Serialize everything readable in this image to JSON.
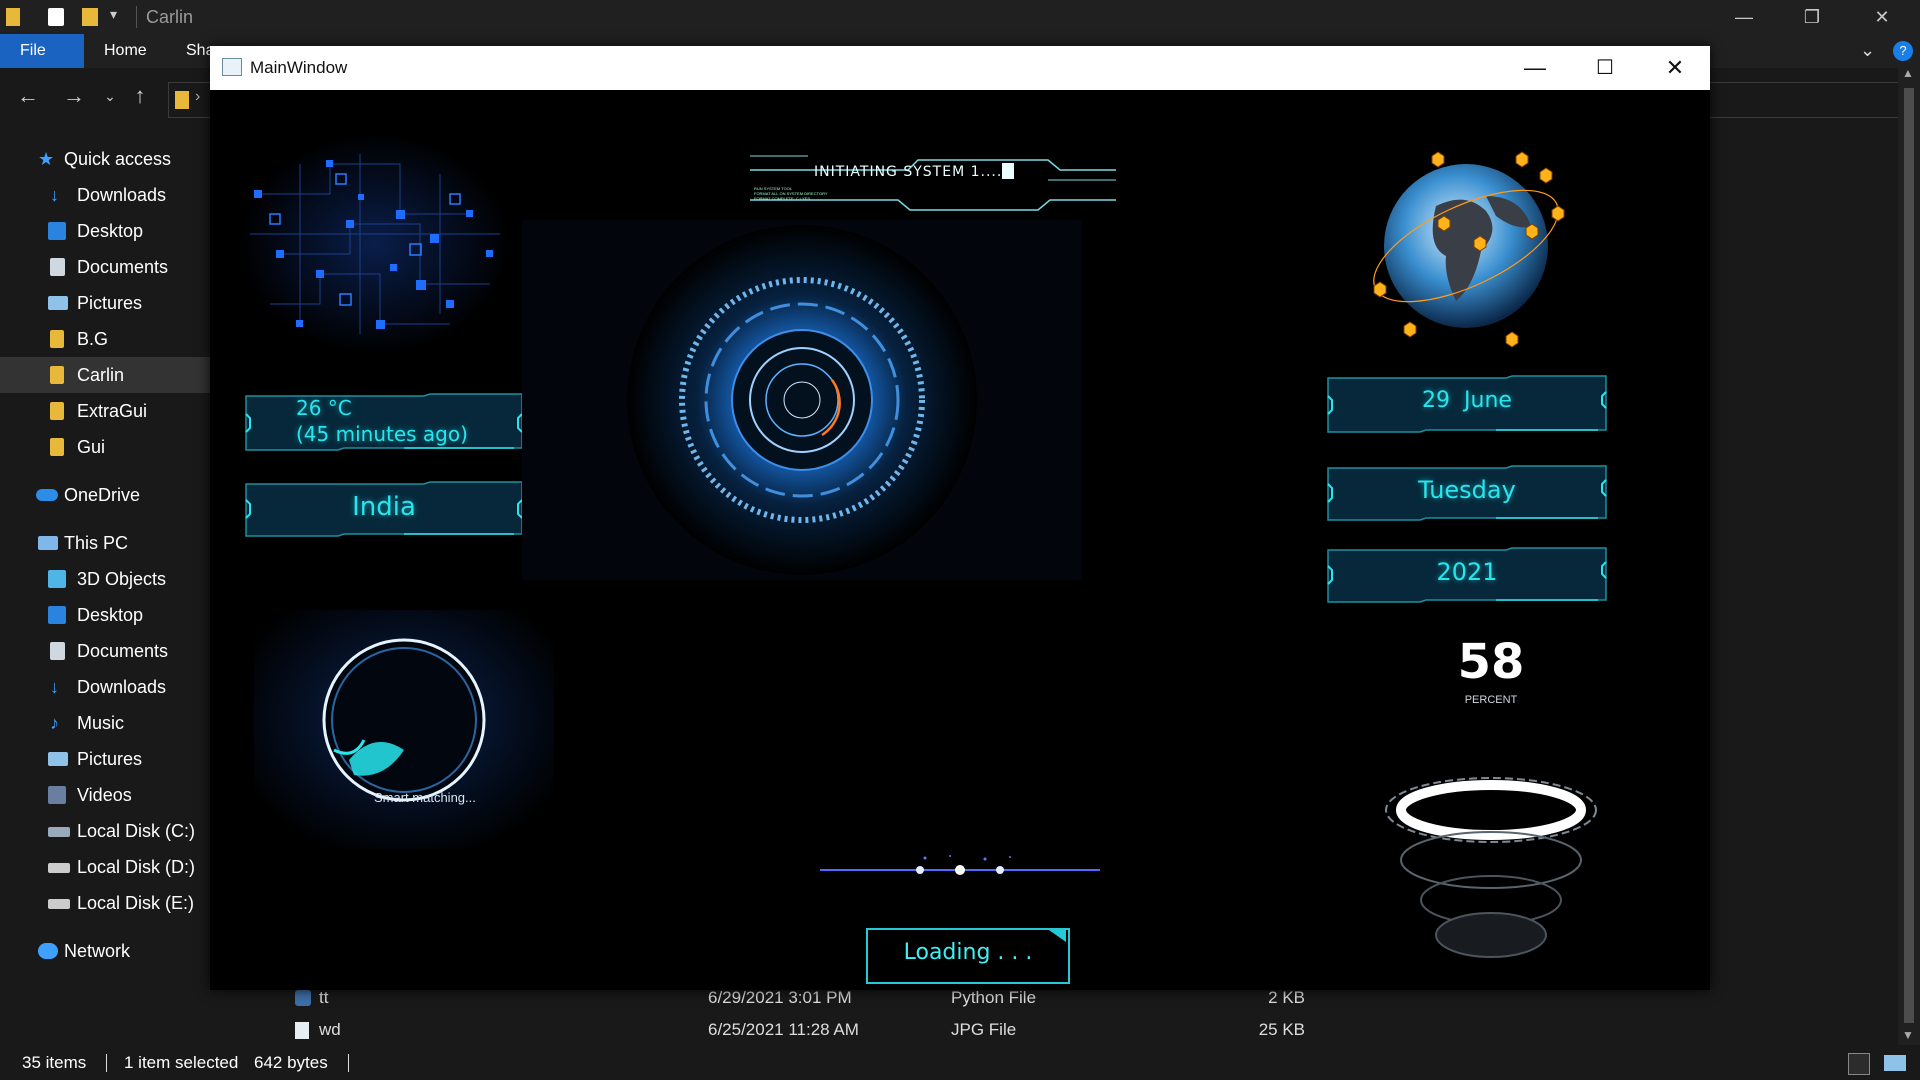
{
  "explorer": {
    "title": "Carlin",
    "ribbon_tabs": [
      "File",
      "Home",
      "Sha"
    ],
    "sidebar": {
      "quick_access": "Quick access",
      "quick_items": [
        "Downloads",
        "Desktop",
        "Documents",
        "Pictures",
        "B.G",
        "Carlin",
        "ExtraGui",
        "Gui"
      ],
      "onedrive": "OneDrive",
      "this_pc": "This PC",
      "pc_items": [
        "3D Objects",
        "Desktop",
        "Documents",
        "Downloads",
        "Music",
        "Pictures",
        "Videos",
        "Local Disk (C:)",
        "Local Disk (D:)",
        "Local Disk (E:)"
      ],
      "network": "Network"
    },
    "files": [
      {
        "name": "tt",
        "date": "6/29/2021 3:01 PM",
        "type": "Python File",
        "size": "2 KB"
      },
      {
        "name": "wd",
        "date": "6/25/2021 11:28 AM",
        "type": "JPG File",
        "size": "25 KB"
      }
    ],
    "status": {
      "items": "35 items",
      "selected": "1 item selected",
      "size": "642 bytes"
    }
  },
  "mainwindow": {
    "title": "MainWindow",
    "banner": {
      "text": "INITIATING SYSTEM 1....",
      "subtext": [
        "RUN SYSTEM TOOL",
        "FORMAT ALL ON SYSTEM DIRECTORY",
        "FORMAT COMPLETE: C:\\ YES"
      ]
    },
    "weather": {
      "temp": "26 °C",
      "age": "(45 minutes ago)"
    },
    "country": "India",
    "date": {
      "day_month": "29  June",
      "weekday": "Tuesday",
      "year": "2021"
    },
    "assistant_caption": "Smart matching...",
    "loading": "Loading . . .",
    "battery": {
      "value": "58",
      "unit": "PERCENT"
    }
  },
  "colors": {
    "accent": "#27e6ee",
    "ribbon_active": "#1a63c1",
    "hud_blue": "#1e6dff"
  }
}
